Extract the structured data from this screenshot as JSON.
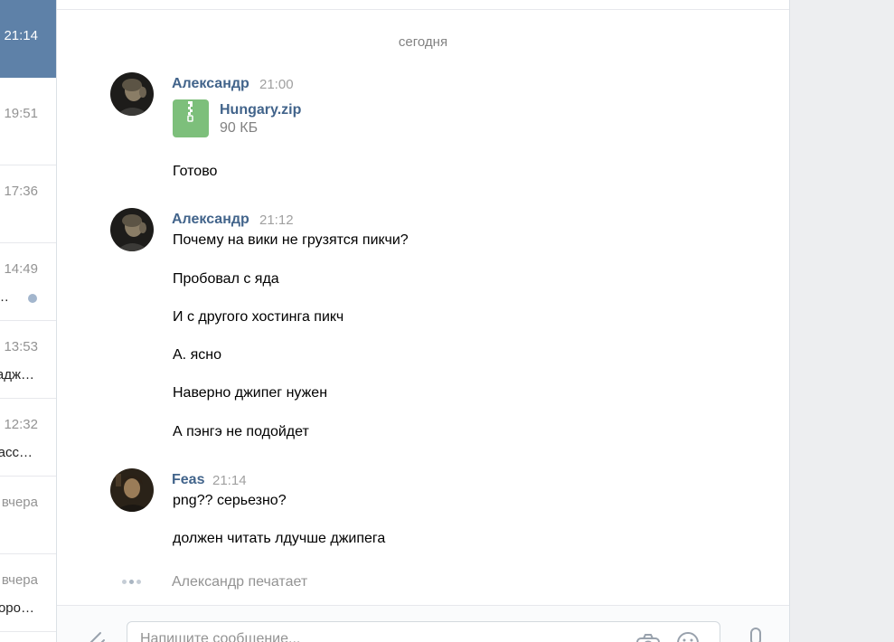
{
  "dialogs": [
    {
      "time": "21:14",
      "snippet": "",
      "active": true,
      "unread": false
    },
    {
      "time": "19:51",
      "snippet": "",
      "active": false,
      "unread": false
    },
    {
      "time": "17:36",
      "snippet": "",
      "active": false,
      "unread": false
    },
    {
      "time": "14:49",
      "snippet": "…",
      "active": false,
      "unread": true
    },
    {
      "time": "13:53",
      "snippet": "адж…",
      "active": false,
      "unread": false
    },
    {
      "time": "12:32",
      "snippet": "асс…",
      "active": false,
      "unread": false
    },
    {
      "time": "вчера",
      "snippet": "",
      "active": false,
      "unread": false
    },
    {
      "time": "вчера",
      "snippet": "оро…",
      "active": false,
      "unread": false
    }
  ],
  "chat": {
    "date_separator": "сегодня",
    "messages": [
      {
        "author": "Александр",
        "time": "21:00",
        "attachment": {
          "name": "Hungary.zip",
          "size": "90 КБ"
        },
        "texts": [
          "Готово"
        ]
      },
      {
        "author": "Александр",
        "time": "21:12",
        "texts": [
          "Почему на вики не грузятся пикчи?",
          "Пробовал с яда",
          "И с другого хостинга пикч",
          "А. ясно",
          "Наверно джипег нужен",
          "А пэнгэ не подойдет"
        ]
      },
      {
        "author": "Feas",
        "time": "21:14",
        "texts": [
          "png?? серьезно?",
          "должен читать лдучше джипега"
        ]
      }
    ],
    "typing": "Александр печатает"
  },
  "composer": {
    "placeholder": "Напишите сообщение..."
  },
  "colors": {
    "accent": "#5e81a8",
    "author": "#42648b",
    "file_icon": "#7dbf7b",
    "sidebar_right": "#edeef0"
  },
  "icons": {
    "attach": "paperclip-icon",
    "camera": "camera-icon",
    "smile": "smile-icon",
    "mic": "microphone-icon",
    "file": "zip-file-icon"
  }
}
